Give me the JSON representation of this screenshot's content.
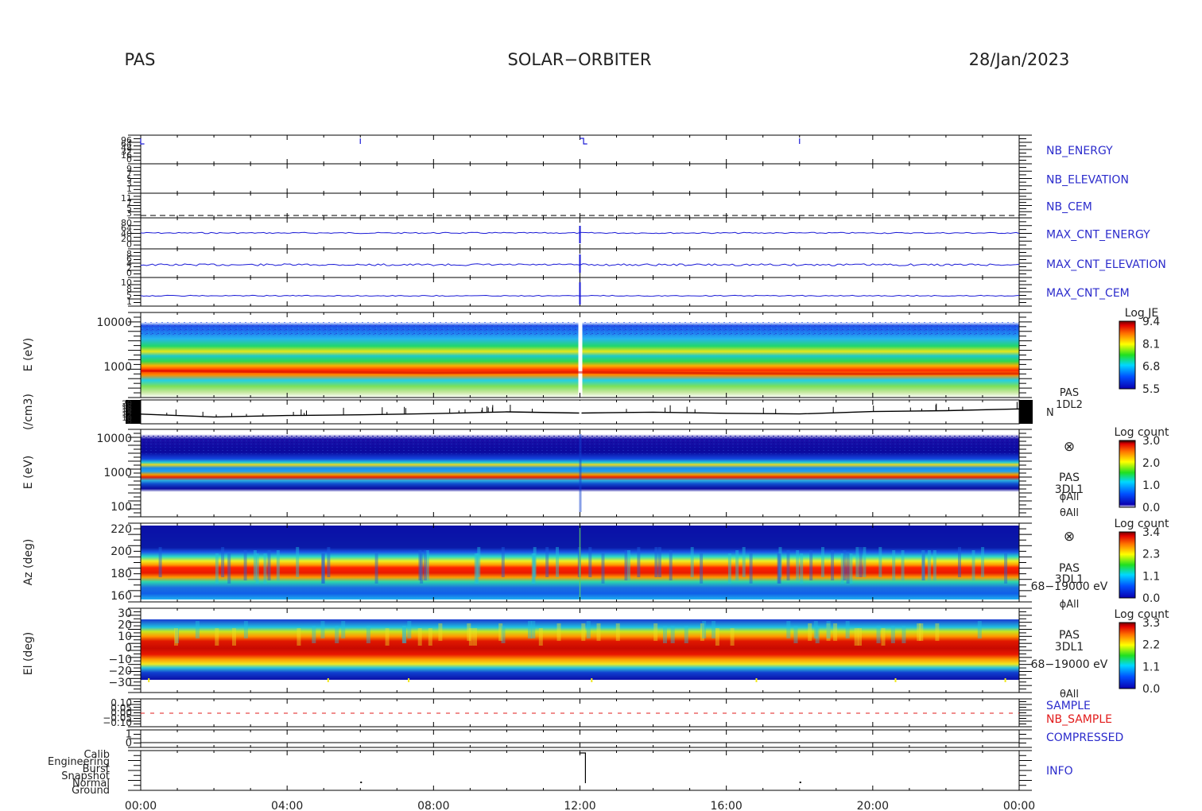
{
  "header": {
    "instrument": "PAS",
    "mission": "SOLAR−ORBITER",
    "date": "28/Jan/2023"
  },
  "time_axis": {
    "ticks": [
      "00:00",
      "04:00",
      "08:00",
      "12:00",
      "16:00",
      "20:00",
      "00:00"
    ]
  },
  "colors": {
    "hk_label": "#2b2bcc",
    "hk_label_alt": "#e21b1b",
    "trace": "#1a1ad6",
    "density": "#000000"
  },
  "chart_data": [
    {
      "type": "line",
      "panel": "NB_ENERGY",
      "label": "NB_ENERGY",
      "ytick_labels": [
        "96",
        "64",
        "48",
        "32",
        "16",
        "0"
      ],
      "events": [
        "00:00",
        "06:00",
        "12:00",
        "18:00"
      ]
    },
    {
      "type": "line",
      "panel": "NB_ELEVATION",
      "label": "NB_ELEVATION",
      "ytick_labels": [
        "9",
        "7",
        "5",
        "3",
        "1"
      ]
    },
    {
      "type": "line",
      "panel": "NB_CEM",
      "label": "NB_CEM",
      "ytick_labels": [
        "11",
        "7",
        "5",
        "3"
      ]
    },
    {
      "type": "line",
      "panel": "MAX_CNT_ENERGY",
      "label": "MAX_CNT_ENERGY",
      "ytick_labels": [
        "80",
        "64",
        "40",
        "20",
        "0"
      ]
    },
    {
      "type": "line",
      "panel": "MAX_CNT_ELEVATION",
      "label": "MAX_CNT_ELEVATION",
      "ytick_labels": [
        "8",
        "6",
        "4",
        "2",
        "0"
      ]
    },
    {
      "type": "line",
      "panel": "MAX_CNT_CEM",
      "label": "MAX_CNT_CEM",
      "ytick_labels": [
        "10",
        "8",
        "5",
        "1"
      ]
    },
    {
      "type": "heatmap",
      "panel": "energy_spectrogram_JE",
      "ylabel": "E (eV)",
      "ytick_labels": [
        "10000",
        "1000"
      ],
      "yscale": "log",
      "colorbar": {
        "title": "Log JE",
        "ticks": [
          "9.4",
          "8.1",
          "6.8",
          "5.5"
        ]
      },
      "peak_energy_eV": {
        "x_hours": [
          0,
          4,
          8,
          12,
          16,
          20,
          24
        ],
        "y": [
          800,
          760,
          720,
          740,
          700,
          680,
          690
        ]
      }
    },
    {
      "type": "line",
      "panel": "density",
      "ylabel": "(/cm3)",
      "ytick_labels": [
        "20",
        "18",
        "16",
        "14",
        "12",
        "10",
        "8"
      ],
      "labels": [
        "PAS",
        "1DL2",
        "N"
      ],
      "x_hours": [
        0,
        2,
        4,
        6,
        8,
        10,
        12,
        14,
        16,
        18,
        20,
        22,
        24
      ],
      "values": [
        12.5,
        10.5,
        11.5,
        12.0,
        12.8,
        14.0,
        13.2,
        13.8,
        13.0,
        12.6,
        14.2,
        14.8,
        16.0
      ]
    },
    {
      "type": "heatmap",
      "panel": "energy_spectrogram_counts",
      "ylabel": "E (eV)",
      "ytick_labels": [
        "10000",
        "1000",
        "100"
      ],
      "yscale": "log",
      "labels": [
        "⊗",
        "PAS",
        "3DL1",
        "ϕAll",
        "θAll"
      ],
      "colorbar": {
        "title": "Log count",
        "ticks": [
          "3.0",
          "2.0",
          "1.0",
          "0.0"
        ]
      }
    },
    {
      "type": "heatmap",
      "panel": "azimuth_spectrogram",
      "ylabel": "Az (deg)",
      "ytick_labels": [
        "220",
        "200",
        "180",
        "160"
      ],
      "ylim": [
        155,
        225
      ],
      "labels": [
        "⊗",
        "PAS",
        "3DL1",
        "68−19000 eV",
        "ϕAll"
      ],
      "colorbar": {
        "title": "Log count",
        "ticks": [
          "3.4",
          "2.3",
          "1.1",
          "0.0"
        ]
      }
    },
    {
      "type": "heatmap",
      "panel": "elevation_spectrogram",
      "ylabel": "El (deg)",
      "ytick_labels": [
        "30",
        "20",
        "10",
        "0",
        "−10",
        "−20",
        "−30"
      ],
      "ylim": [
        -30,
        30
      ],
      "labels": [
        "PAS",
        "3DL1",
        "68−19000 eV",
        "θAll"
      ],
      "colorbar": {
        "title": "Log count",
        "ticks": [
          "3.3",
          "2.2",
          "1.1",
          "0.0"
        ]
      }
    },
    {
      "type": "line",
      "panel": "sample",
      "ytick_labels": [
        "0.10",
        "0.05",
        "0.00",
        "−0.05",
        "−0.10"
      ],
      "labels": [
        "SAMPLE",
        "NB_SAMPLE"
      ]
    },
    {
      "type": "line",
      "panel": "compressed",
      "ytick_labels": [
        "1",
        "0"
      ],
      "labels": [
        "COMPRESSED"
      ]
    },
    {
      "type": "line",
      "panel": "info",
      "ytick_labels": [
        "Calib",
        "Engineering",
        "Burst",
        "Snapshot",
        "Normal",
        "Ground"
      ],
      "labels": [
        "INFO"
      ]
    }
  ]
}
